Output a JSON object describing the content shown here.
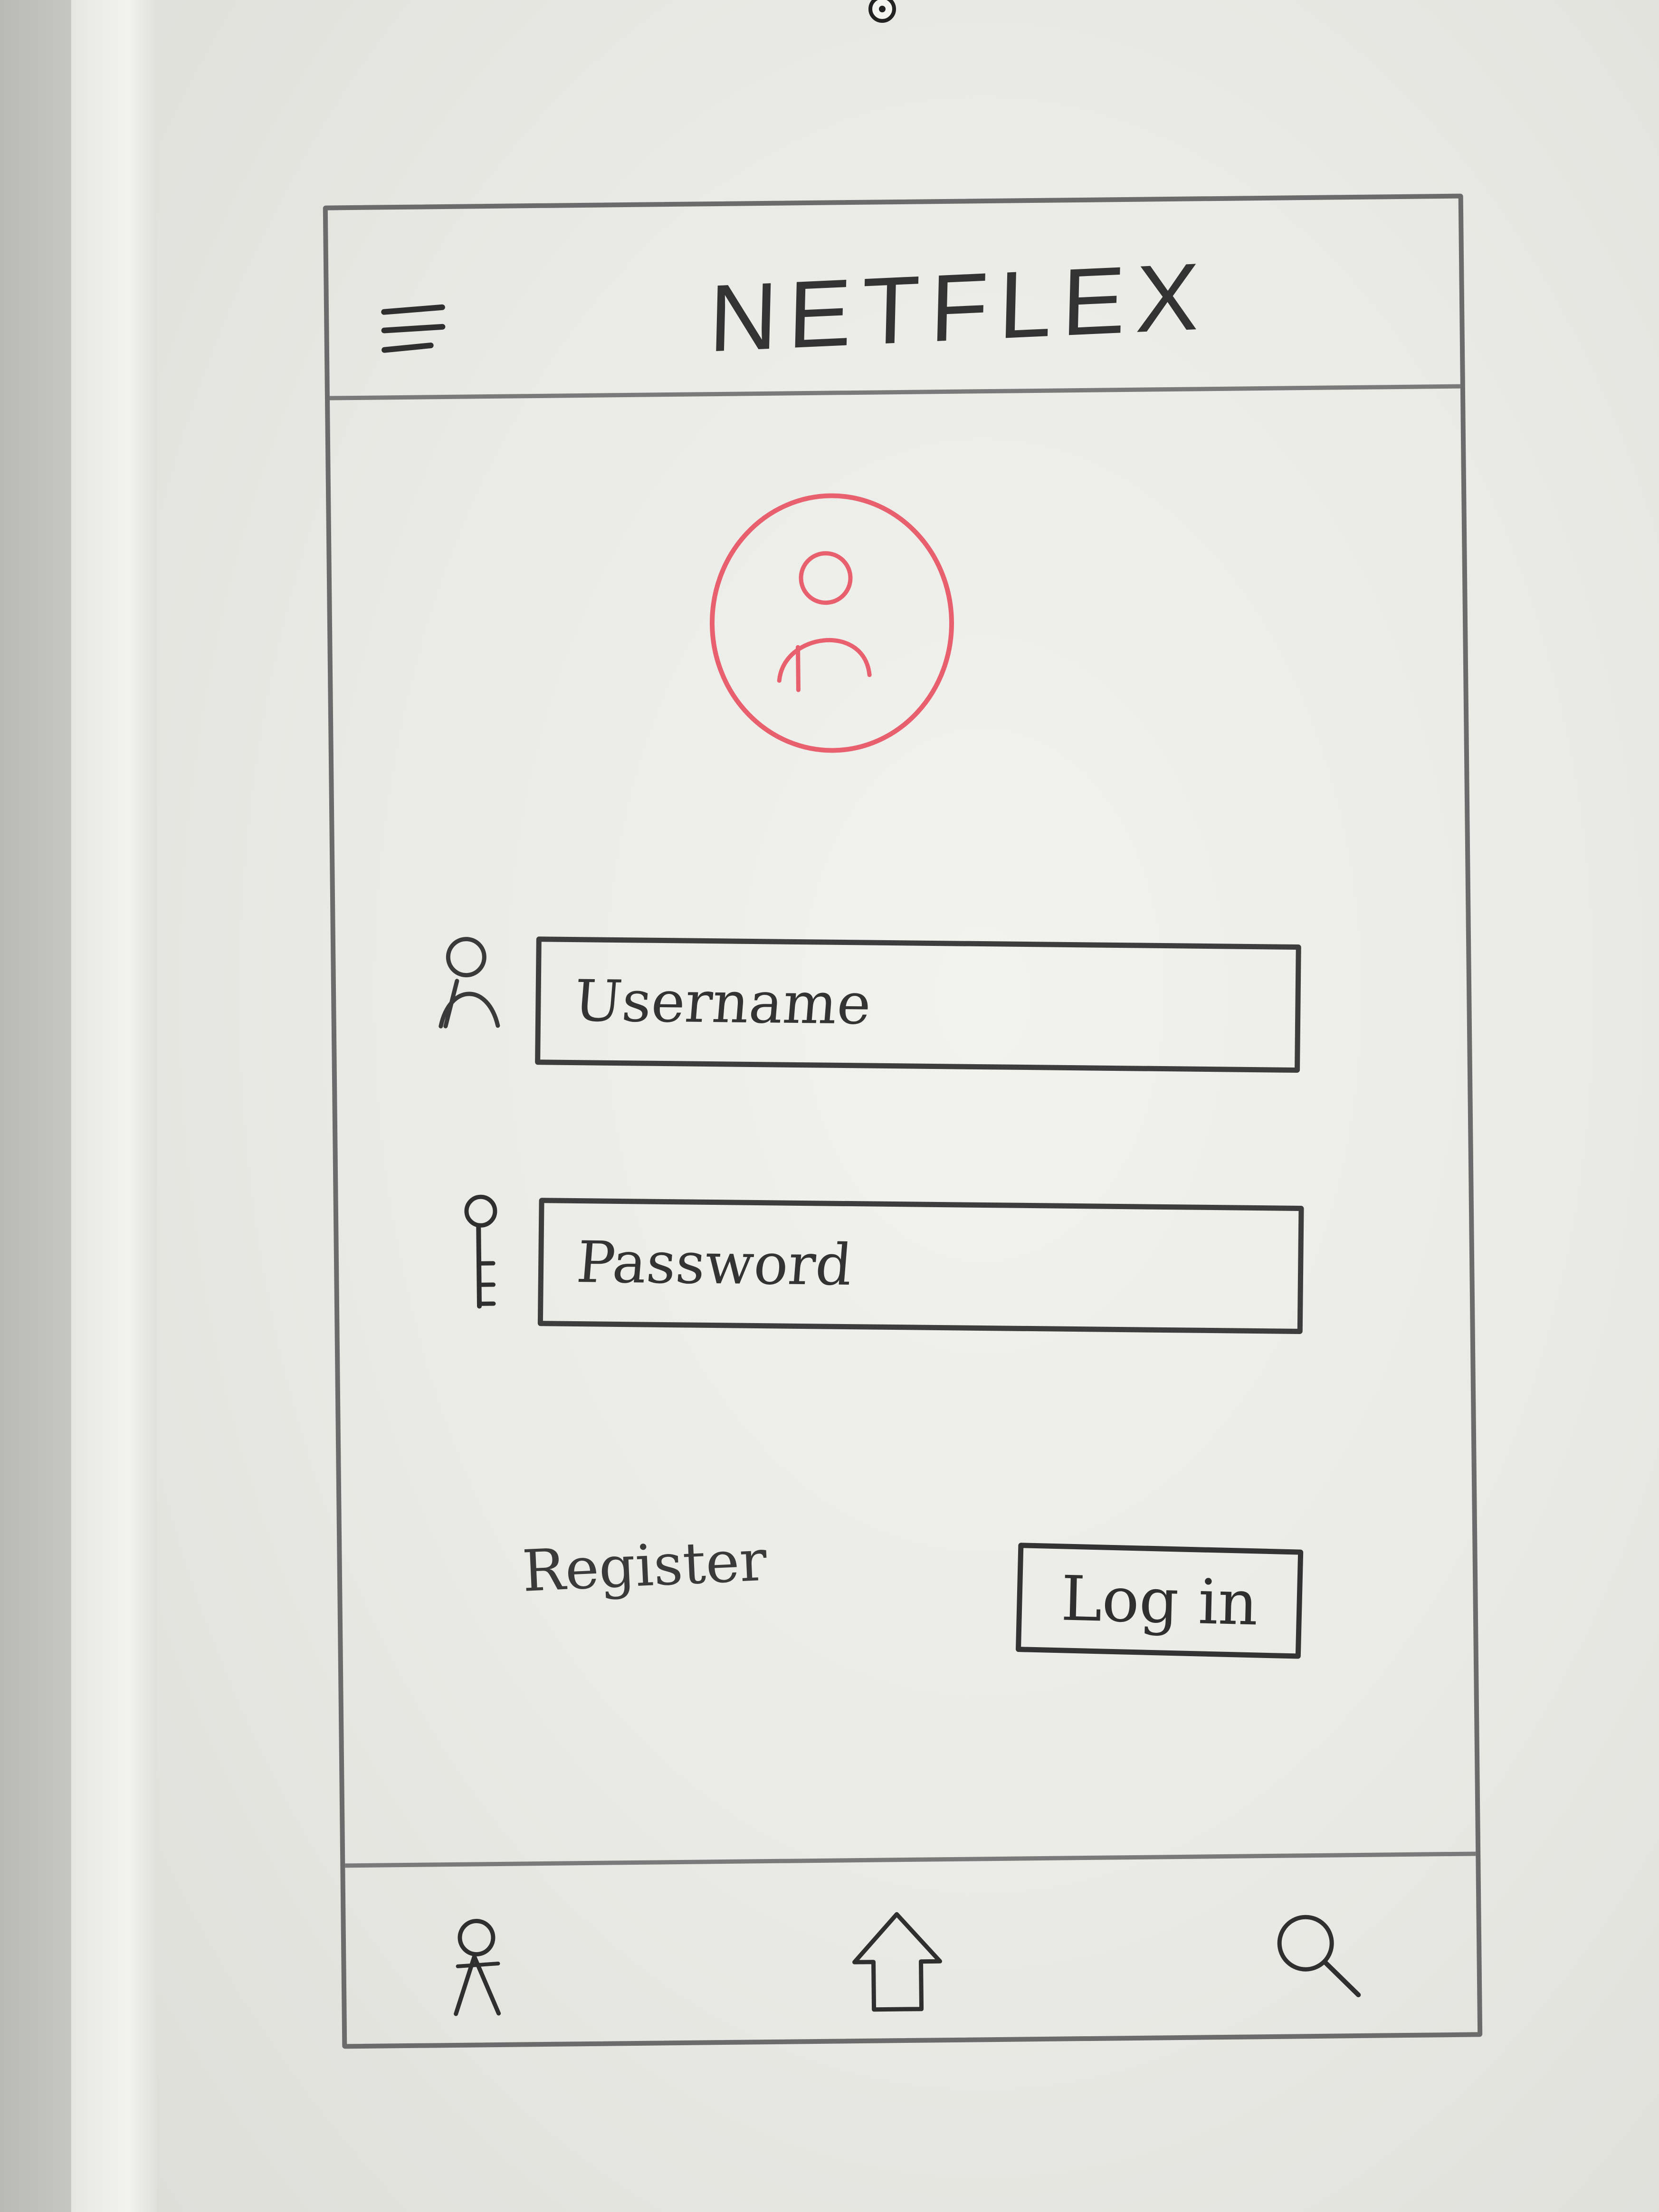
{
  "header": {
    "title": "NETFLEX",
    "menu_icon": "hamburger-menu-icon"
  },
  "profile": {
    "avatar_icon": "user-avatar-icon",
    "avatar_color": "#e8606e"
  },
  "form": {
    "username": {
      "placeholder": "Username",
      "icon": "user-icon"
    },
    "password": {
      "placeholder": "Password",
      "icon": "key-icon"
    }
  },
  "actions": {
    "register_label": "Register",
    "login_label": "Log in"
  },
  "bottom_nav": {
    "items": [
      {
        "icon": "user-icon"
      },
      {
        "icon": "home-icon"
      },
      {
        "icon": "search-icon"
      }
    ]
  },
  "colors": {
    "marker_dark": "#333333",
    "marker_red": "#e8606e",
    "board": "#ececE8"
  }
}
